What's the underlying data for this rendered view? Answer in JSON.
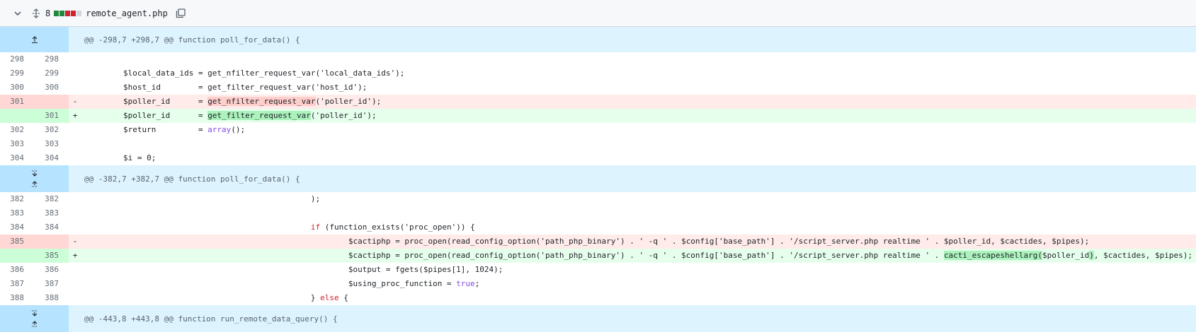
{
  "file": {
    "change_count": "8",
    "name": "remote_agent.php",
    "diffstat_colors": [
      "#1f883d",
      "#1f883d",
      "#cf222e",
      "#cf222e",
      "#d0d7de"
    ]
  },
  "hunks": [
    {
      "header": "@@ -298,7 +298,7 @@ function poll_for_data() {",
      "lines": [
        {
          "type": "ctx",
          "old": "298",
          "new": "298",
          "sign": "",
          "code": ""
        },
        {
          "type": "ctx",
          "old": "299",
          "new": "299",
          "sign": "",
          "code": "        $local_data_ids = get_nfilter_request_var('local_data_ids');"
        },
        {
          "type": "ctx",
          "old": "300",
          "new": "300",
          "sign": "",
          "code": "        $host_id        = get_filter_request_var('host_id');"
        },
        {
          "type": "del",
          "old": "301",
          "new": "",
          "sign": "-",
          "pre": "        $poller_id      = ",
          "hl": "get_nfilter_request_var",
          "post": "('poller_id');"
        },
        {
          "type": "add",
          "old": "",
          "new": "301",
          "sign": "+",
          "pre": "        $poller_id      = ",
          "hl": "get_filter_request_var",
          "post": "('poller_id');"
        },
        {
          "type": "ctx",
          "old": "302",
          "new": "302",
          "sign": "",
          "code": "        $return         = ",
          "fn": "array",
          "post": "();"
        },
        {
          "type": "ctx",
          "old": "303",
          "new": "303",
          "sign": "",
          "code": ""
        },
        {
          "type": "ctx",
          "old": "304",
          "new": "304",
          "sign": "",
          "code": "        $i = 0;"
        }
      ]
    },
    {
      "header": "@@ -382,7 +382,7 @@ function poll_for_data() {",
      "lines": [
        {
          "type": "ctx",
          "old": "382",
          "new": "382",
          "sign": "",
          "code": "                                                );"
        },
        {
          "type": "ctx",
          "old": "383",
          "new": "383",
          "sign": "",
          "code": ""
        },
        {
          "type": "ctx",
          "old": "384",
          "new": "384",
          "sign": "",
          "kw": "if",
          "code": "                                                ",
          "post": " (function_exists('proc_open')) {"
        },
        {
          "type": "del",
          "old": "385",
          "new": "",
          "sign": "-",
          "pre": "                                                        $cactiphp = proc_open(read_config_option('path_php_binary') . ' -q ' . $config['base_path'] . '/script_server.php realtime ' . $poller_id, $cactides, $pipes);",
          "hl": "",
          "post": ""
        },
        {
          "type": "add",
          "old": "",
          "new": "385",
          "sign": "+",
          "pre": "                                                        $cactiphp = proc_open(read_config_option('path_php_binary') . ' -q ' . $config['base_path'] . '/script_server.php realtime ' . ",
          "hl": "cacti_escapeshellarg(",
          "mid": "$poller_id",
          "hl2": ")",
          "post": ", $cactides, $pipes);"
        },
        {
          "type": "ctx",
          "old": "386",
          "new": "386",
          "sign": "",
          "code": "                                                        $output = fgets($pipes[1], 1024);"
        },
        {
          "type": "ctx",
          "old": "387",
          "new": "387",
          "sign": "",
          "code": "                                                        $using_proc_function = ",
          "kw2": "true",
          "post": ";"
        },
        {
          "type": "ctx",
          "old": "388",
          "new": "388",
          "sign": "",
          "code": "                                                } ",
          "kw3": "else",
          "post": " {"
        }
      ]
    },
    {
      "header": "@@ -443,8 +443,8 @@ function run_remote_data_query() {",
      "lines": []
    }
  ]
}
